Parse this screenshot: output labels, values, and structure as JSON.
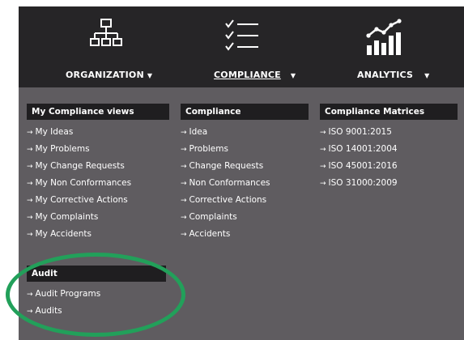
{
  "nav": {
    "items": [
      {
        "label": "ORGANIZATION",
        "icon": "org-chart-icon",
        "caret": "▼",
        "active": false
      },
      {
        "label": "COMPLIANCE",
        "icon": "checklist-icon",
        "caret": "▼",
        "active": true
      },
      {
        "label": "ANALYTICS",
        "icon": "bar-chart-trend-icon",
        "caret": "▼",
        "active": false
      }
    ]
  },
  "arrow_glyph": "→",
  "sections": {
    "my_views": {
      "title": "My Compliance views",
      "links": [
        "My Ideas",
        "My Problems",
        "My Change Requests",
        "My Non Conformances",
        "My Corrective Actions",
        "My Complaints",
        "My Accidents"
      ]
    },
    "compliance": {
      "title": "Compliance",
      "links": [
        "Idea",
        "Problems",
        "Change Requests",
        "Non Conformances",
        "Corrective Actions",
        "Complaints",
        "Accidents"
      ]
    },
    "matrices": {
      "title": "Compliance Matrices",
      "links": [
        "ISO 9001:2015",
        "ISO 14001:2004",
        "ISO 45001:2016",
        "ISO 31000:2009"
      ]
    },
    "audit": {
      "title": "Audit",
      "links": [
        "Audit Programs",
        "Audits"
      ]
    }
  },
  "colors": {
    "topbar": "#262527",
    "panel": "#5f5c60",
    "header": "#1f1e20",
    "highlight": "#22a05a"
  }
}
